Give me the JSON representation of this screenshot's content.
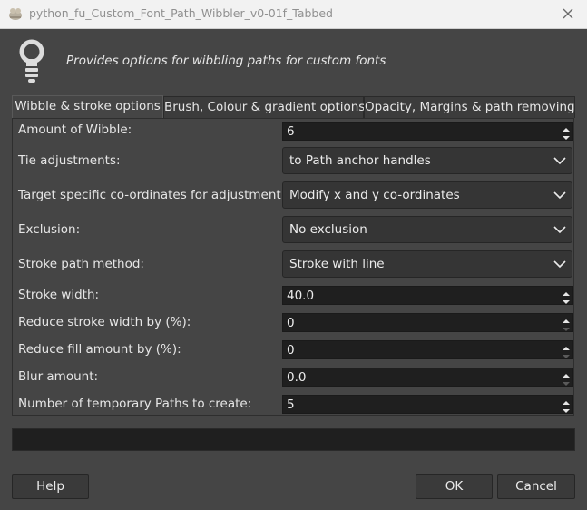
{
  "window": {
    "title": "python_fu_Custom_Font_Path_Wibbler_v0-01f_Tabbed",
    "close_icon": "close-icon"
  },
  "header": {
    "icon": "lightbulb-icon",
    "description": "Provides options for wibbling paths for custom fonts"
  },
  "tabs": [
    {
      "label": "Wibble & stroke options",
      "active": true
    },
    {
      "label": "Brush, Colour & gradient options",
      "active": false
    },
    {
      "label": "Opacity, Margins & path removing",
      "active": false
    }
  ],
  "fields": {
    "amount_of_wibble": {
      "label": "Amount of Wibble:",
      "value": "6"
    },
    "tie_adjustments": {
      "label": "Tie adjustments:",
      "value": "to Path anchor handles"
    },
    "target_coords": {
      "label": "Target specific co-ordinates for adjustment:",
      "value": "Modify x and y co-ordinates"
    },
    "exclusion": {
      "label": "Exclusion:",
      "value": "No exclusion"
    },
    "stroke_method": {
      "label": "Stroke path method:",
      "value": "Stroke with line"
    },
    "stroke_width": {
      "label": "Stroke width:",
      "value": "40.0"
    },
    "reduce_stroke": {
      "label": "Reduce stroke width by (%):",
      "value": "0"
    },
    "reduce_fill": {
      "label": "Reduce fill amount by (%):",
      "value": "0"
    },
    "blur_amount": {
      "label": "Blur amount:",
      "value": "0.0"
    },
    "temp_paths": {
      "label": "Number of temporary Paths to create:",
      "value": "5"
    }
  },
  "progress": {
    "value": 0
  },
  "buttons": {
    "help": "Help",
    "ok": "OK",
    "cancel": "Cancel"
  },
  "colors": {
    "background": "#454545",
    "field": "#1f1f1f",
    "text": "#e6e6e6"
  }
}
